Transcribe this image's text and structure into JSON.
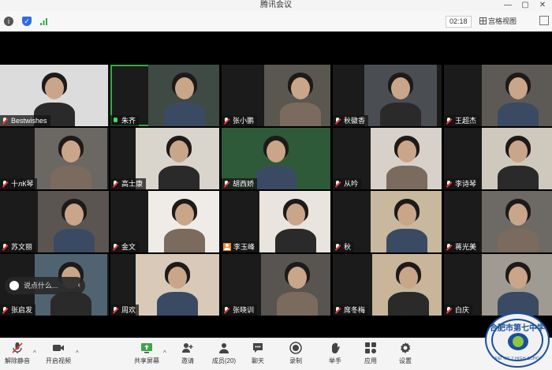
{
  "window": {
    "title": "腾讯会议",
    "controls": [
      "—",
      "▢",
      "✕"
    ]
  },
  "topbar": {
    "timer": "02:18",
    "view_label": "宫格视图",
    "icons": [
      "info-icon",
      "shield-icon",
      "signal-icon"
    ]
  },
  "colors": {
    "active_speaker": "#3aa845",
    "muted": "#e33333",
    "host_badge": "#f18a1f"
  },
  "participants": [
    {
      "name": "Bestwishes",
      "mic": "muted"
    },
    {
      "name": "朱齐",
      "mic": "on",
      "active": true
    },
    {
      "name": "张小鹏",
      "mic": "muted"
    },
    {
      "name": "秋徽香",
      "mic": "muted"
    },
    {
      "name": "王超杰",
      "mic": "muted"
    },
    {
      "name": "十лК琴",
      "mic": "muted"
    },
    {
      "name": "高士康",
      "mic": "muted"
    },
    {
      "name": "胡西娇",
      "mic": "muted"
    },
    {
      "name": "从吟",
      "mic": "muted"
    },
    {
      "name": "李诗琴",
      "mic": "muted"
    },
    {
      "name": "苏文丽",
      "mic": "muted"
    },
    {
      "name": "金文",
      "mic": "muted"
    },
    {
      "name": "李玉峰",
      "mic": "host"
    },
    {
      "name": "秋",
      "mic": "muted"
    },
    {
      "name": "蒋光美",
      "mic": "muted"
    },
    {
      "name": "张启发",
      "mic": "muted"
    },
    {
      "name": "周欢",
      "mic": "muted"
    },
    {
      "name": "张晓训",
      "mic": "muted"
    },
    {
      "name": "席冬梅",
      "mic": "muted"
    },
    {
      "name": "白庆",
      "mic": "muted"
    }
  ],
  "chat_preview": {
    "text": "说点什么..."
  },
  "toolbar": {
    "items": [
      {
        "label": "解除静音",
        "icon": "mic-muted-icon"
      },
      {
        "label": "开启视频",
        "icon": "camera-icon"
      },
      {
        "label": "共享屏幕",
        "icon": "share-screen-icon"
      },
      {
        "label": "邀请",
        "icon": "invite-icon"
      },
      {
        "label": "成员(20)",
        "icon": "members-icon"
      },
      {
        "label": "聊天",
        "icon": "chat-icon"
      },
      {
        "label": "录制",
        "icon": "record-icon"
      },
      {
        "label": "举手",
        "icon": "raise-hand-icon"
      },
      {
        "label": "应用",
        "icon": "apps-icon"
      },
      {
        "label": "设置",
        "icon": "settings-icon"
      }
    ]
  },
  "school_logo": {
    "top_text": "合肥市第七中学",
    "bottom_text": "HEFEI NO.7 HIGH SCHOOL"
  }
}
